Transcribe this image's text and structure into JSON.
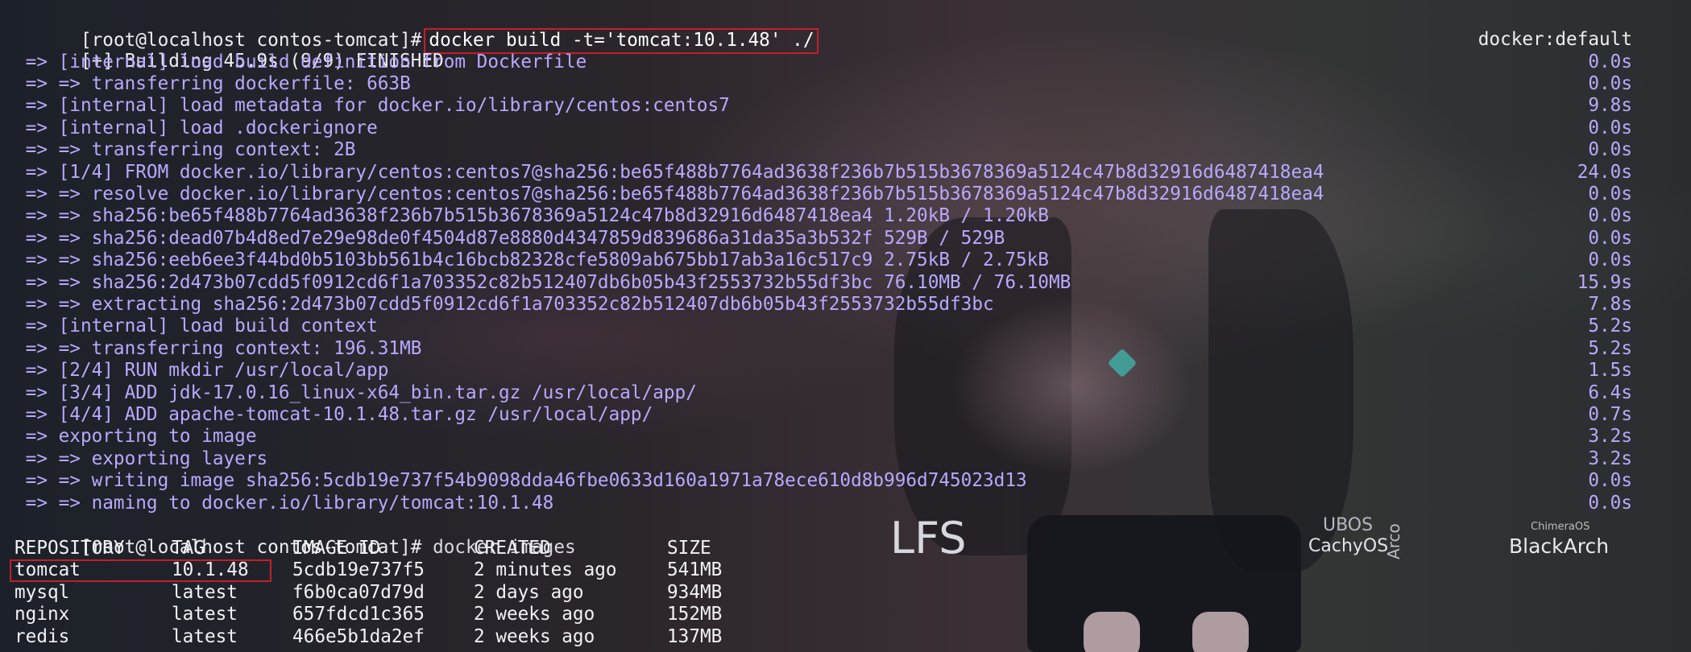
{
  "terminal": {
    "prompt": "[root@localhost contos-tomcat]#",
    "build_command": "docker build -t='tomcat:10.1.48' ./",
    "status": "[+] Building 45.9s (9/9) FINISHED",
    "builder": "docker:default",
    "build_steps": [
      {
        "text": " => [internal] load build definition from Dockerfile",
        "time": "0.0s"
      },
      {
        "text": " => => transferring dockerfile: 663B",
        "time": "0.0s"
      },
      {
        "text": " => [internal] load metadata for docker.io/library/centos:centos7",
        "time": "9.8s"
      },
      {
        "text": " => [internal] load .dockerignore",
        "time": "0.0s"
      },
      {
        "text": " => => transferring context: 2B",
        "time": "0.0s"
      },
      {
        "text": " => [1/4] FROM docker.io/library/centos:centos7@sha256:be65f488b7764ad3638f236b7b515b3678369a5124c47b8d32916d6487418ea4",
        "time": "24.0s"
      },
      {
        "text": " => => resolve docker.io/library/centos:centos7@sha256:be65f488b7764ad3638f236b7b515b3678369a5124c47b8d32916d6487418ea4",
        "time": "0.0s"
      },
      {
        "text": " => => sha256:be65f488b7764ad3638f236b7b515b3678369a5124c47b8d32916d6487418ea4 1.20kB / 1.20kB",
        "time": "0.0s"
      },
      {
        "text": " => => sha256:dead07b4d8ed7e29e98de0f4504d87e8880d4347859d839686a31da35a3b532f 529B / 529B",
        "time": "0.0s"
      },
      {
        "text": " => => sha256:eeb6ee3f44bd0b5103bb561b4c16bcb82328cfe5809ab675bb17ab3a16c517c9 2.75kB / 2.75kB",
        "time": "0.0s"
      },
      {
        "text": " => => sha256:2d473b07cdd5f0912cd6f1a703352c82b512407db6b05b43f2553732b55df3bc 76.10MB / 76.10MB",
        "time": "15.9s"
      },
      {
        "text": " => => extracting sha256:2d473b07cdd5f0912cd6f1a703352c82b512407db6b05b43f2553732b55df3bc",
        "time": "7.8s"
      },
      {
        "text": " => [internal] load build context",
        "time": "5.2s"
      },
      {
        "text": " => => transferring context: 196.31MB",
        "time": "5.2s"
      },
      {
        "text": " => [2/4] RUN mkdir /usr/local/app",
        "time": "1.5s"
      },
      {
        "text": " => [3/4] ADD jdk-17.0.16_linux-x64_bin.tar.gz /usr/local/app/",
        "time": "6.4s"
      },
      {
        "text": " => [4/4] ADD apache-tomcat-10.1.48.tar.gz /usr/local/app/",
        "time": "0.7s"
      },
      {
        "text": " => exporting to image",
        "time": "3.2s"
      },
      {
        "text": " => => exporting layers",
        "time": "3.2s"
      },
      {
        "text": " => => writing image sha256:5cdb19e737f54b9098dda46fbe0633d160a1971a78ece610d8b996d745023d13",
        "time": "0.0s"
      },
      {
        "text": " => => naming to docker.io/library/tomcat:10.1.48",
        "time": "0.0s"
      }
    ],
    "images_command": "docker images",
    "images_headers": [
      "REPOSITORY",
      "TAG",
      "IMAGE ID",
      "CREATED",
      "SIZE"
    ],
    "images_rows": [
      {
        "repository": "tomcat",
        "tag": "10.1.48",
        "image_id": "5cdb19e737f5",
        "created": "2 minutes ago",
        "size": "541MB"
      },
      {
        "repository": "mysql",
        "tag": "latest",
        "image_id": "f6b0ca07d79d",
        "created": "2 days ago",
        "size": "934MB"
      },
      {
        "repository": "nginx",
        "tag": "latest",
        "image_id": "657fdcd1c365",
        "created": "2 weeks ago",
        "size": "152MB"
      },
      {
        "repository": "redis",
        "tag": "latest",
        "image_id": "466e5b1da2ef",
        "created": "2 weeks ago",
        "size": "137MB"
      }
    ]
  },
  "wallpaper": {
    "distro_labels": {
      "lfs": "LFS",
      "ubos": "UBOS",
      "cachyos": "CachyOS",
      "arco": "Arco",
      "chimeraos": "ChimeraOS",
      "blackarch": "BlackArch"
    }
  },
  "colors": {
    "step_text": "#b9a9ff",
    "highlight_border": "#c21f2a",
    "terminal_text": "#eeeef2"
  }
}
